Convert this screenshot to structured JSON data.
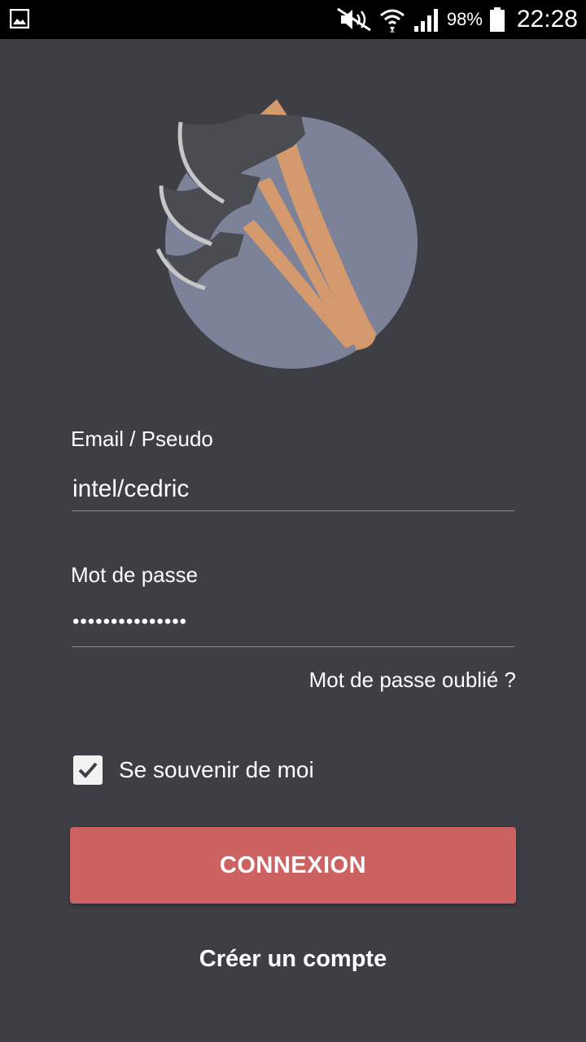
{
  "status_bar": {
    "left_icon": "gallery-icon",
    "icons": [
      "mute-icon",
      "wifi-icon",
      "signal-icon",
      "battery-icon"
    ],
    "battery_percent": "98%",
    "time": "22:28"
  },
  "logo": {
    "icon": "axes-logo",
    "colors": {
      "circle": "#7c8298",
      "blade": "#4b4b52",
      "edge": "#c7c7c7",
      "handle": "#d49a6e"
    }
  },
  "login_form": {
    "email_label": "Email / Pseudo",
    "email_value": "intel/cedric",
    "password_label": "Mot de passe",
    "password_value": "•••••••••••••••",
    "forgot_password": "Mot de passe oublié ?",
    "remember_me": {
      "label": "Se souvenir de moi",
      "checked": true
    },
    "submit_label": "CONNEXION",
    "create_account": "Créer un compte"
  },
  "colors": {
    "background": "#3e3e45",
    "accent_button": "#cd6262",
    "status_bar": "#000000"
  }
}
